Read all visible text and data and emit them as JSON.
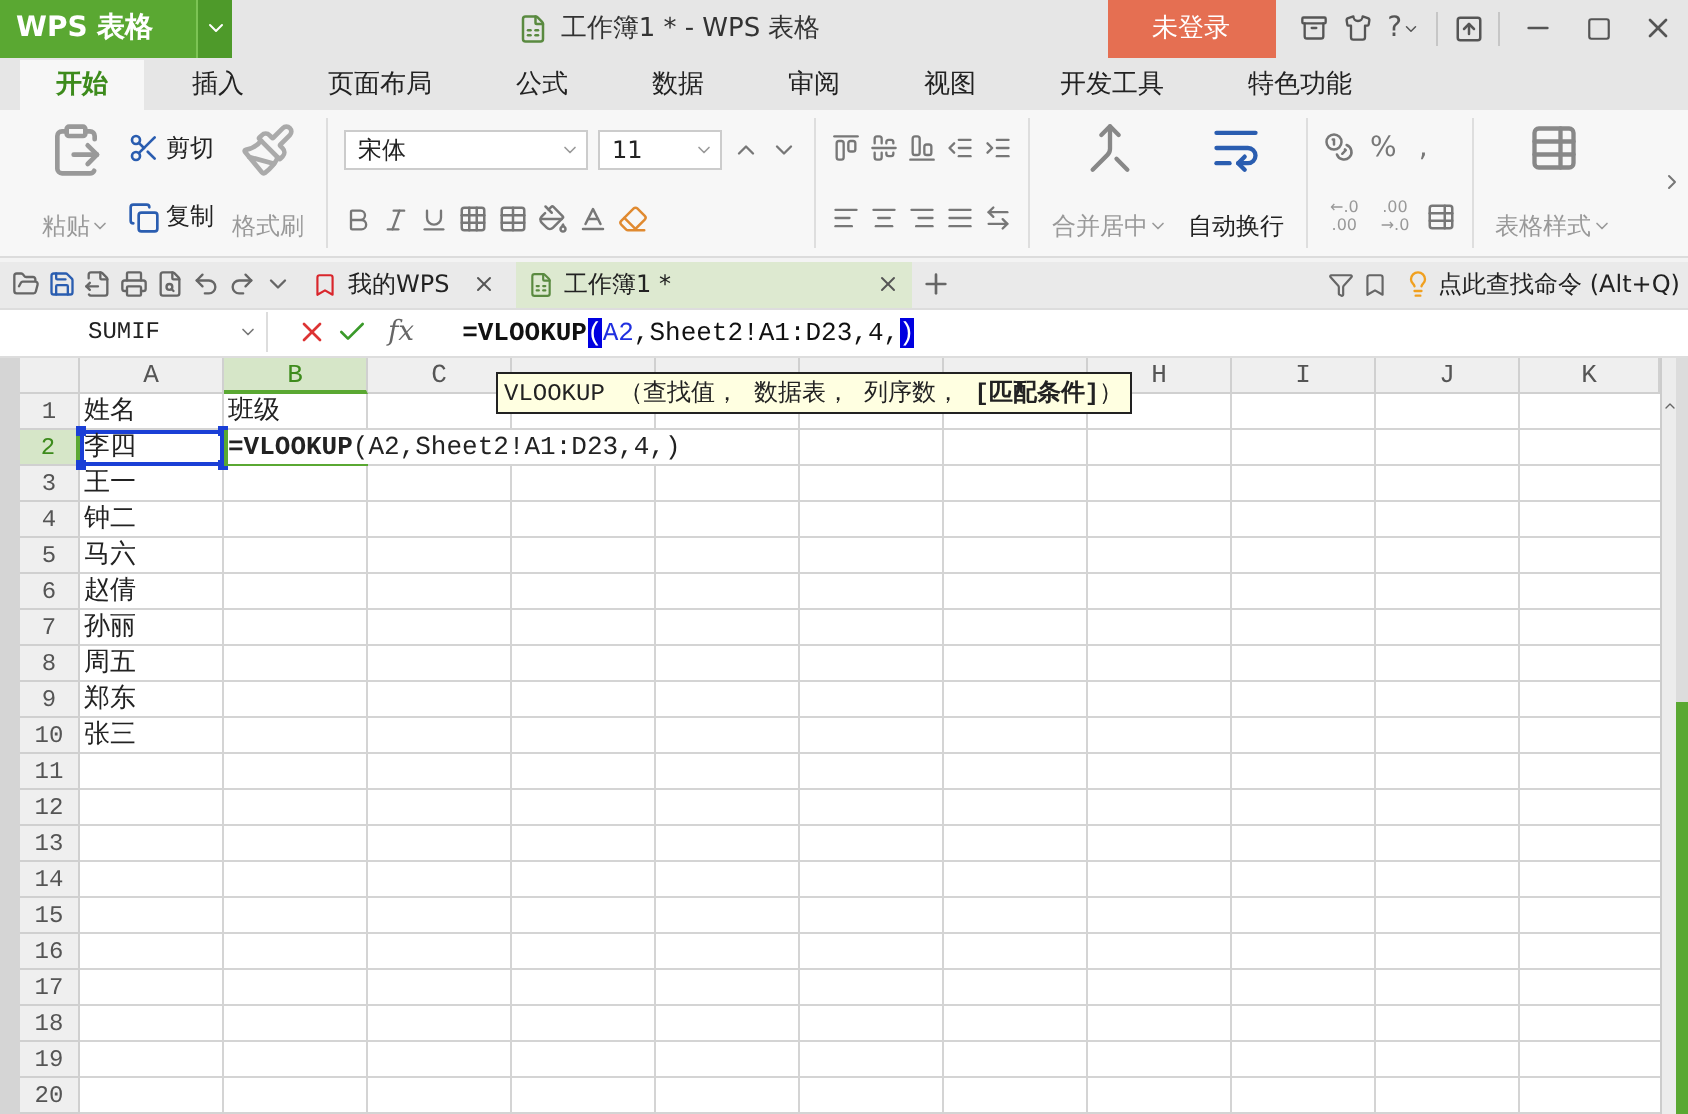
{
  "app_button": {
    "label": "WPS 表格"
  },
  "window": {
    "title": "工作簿1 * - WPS 表格"
  },
  "login_button": {
    "label": "未登录"
  },
  "help_button": {
    "label": "?"
  },
  "menu_tabs": [
    {
      "label": "开始",
      "selected": true
    },
    {
      "label": "插入",
      "selected": false
    },
    {
      "label": "页面布局",
      "selected": false
    },
    {
      "label": "公式",
      "selected": false
    },
    {
      "label": "数据",
      "selected": false
    },
    {
      "label": "审阅",
      "selected": false
    },
    {
      "label": "视图",
      "selected": false
    },
    {
      "label": "开发工具",
      "selected": false
    },
    {
      "label": "特色功能",
      "selected": false
    }
  ],
  "ribbon": {
    "paste": {
      "label": "粘贴",
      "disabled": true
    },
    "cut": {
      "label": "剪切",
      "disabled": false
    },
    "copy": {
      "label": "复制",
      "disabled": false
    },
    "format_painter": {
      "label": "格式刷",
      "disabled": true
    },
    "font_name": "宋体",
    "font_size": "11",
    "merge_center": {
      "label": "合并居中",
      "disabled": true
    },
    "wrap_text": {
      "label": "自动换行",
      "disabled": false
    },
    "percent": "%",
    "comma": ",",
    "decimal_buttons": [
      {
        "top": "←.0",
        "bottom": ".00"
      },
      {
        "top": ".00",
        "bottom": "→.0"
      }
    ],
    "table_style": {
      "label": "表格样式",
      "disabled": true
    }
  },
  "doc_tabs": [
    {
      "label": "我的WPS",
      "kind": "home",
      "selected": false
    },
    {
      "label": "工作簿1 *",
      "kind": "sheet",
      "selected": true
    }
  ],
  "command_search": "点此查找命令 (Alt+Q)",
  "formula_bar": {
    "name_box": "SUMIF",
    "function_button": "fx",
    "formula": [
      {
        "text": "=VLOOKUP",
        "kind": "bold"
      },
      {
        "text": "(",
        "kind": "highlight"
      },
      {
        "text": "A2",
        "kind": "ref"
      },
      {
        "text": ",Sheet2!A1:D23,4,",
        "kind": "plain"
      },
      {
        "text": ")",
        "kind": "highlight"
      }
    ]
  },
  "tooltip": "VLOOKUP （查找值， 数据表， 列序数， **[匹配条件]**）",
  "grid": {
    "columns": [
      {
        "label": "A",
        "selected": false
      },
      {
        "label": "B",
        "selected": true
      },
      {
        "label": "C",
        "selected": false
      },
      {
        "selected": false
      },
      {
        "selected": false
      },
      {
        "selected": false
      },
      {
        "selected": false
      },
      {
        "label": "H",
        "selected": false
      },
      {
        "label": "I",
        "selected": false
      },
      {
        "label": "J",
        "selected": false
      },
      {
        "label": "K",
        "selected": false
      }
    ],
    "rows": [
      {
        "label": "1",
        "selected": false,
        "cells": [
          {
            "text": "姓名",
            "selected": false,
            "editing": false
          },
          {
            "text": "班级",
            "selected": false,
            "editing": false
          }
        ]
      },
      {
        "label": "2",
        "selected": true,
        "cells": [
          {
            "text": "李四",
            "selected": true,
            "editing": false
          },
          {
            "text": "**=VLOOKUP**(A2,Sheet2!A1:D23,4,)",
            "selected": false,
            "editing": true
          }
        ]
      },
      {
        "label": "3",
        "selected": false,
        "cells": [
          {
            "text": "王一",
            "selected": false,
            "editing": false
          }
        ]
      },
      {
        "label": "4",
        "selected": false,
        "cells": [
          {
            "text": "钟二",
            "selected": false,
            "editing": false
          }
        ]
      },
      {
        "label": "5",
        "selected": false,
        "cells": [
          {
            "text": "马六",
            "selected": false,
            "editing": false
          }
        ]
      },
      {
        "label": "6",
        "selected": false,
        "cells": [
          {
            "text": "赵倩",
            "selected": false,
            "editing": false
          }
        ]
      },
      {
        "label": "7",
        "selected": false,
        "cells": [
          {
            "text": "孙丽",
            "selected": false,
            "editing": false
          }
        ]
      },
      {
        "label": "8",
        "selected": false,
        "cells": [
          {
            "text": "周五",
            "selected": false,
            "editing": false
          }
        ]
      },
      {
        "label": "9",
        "selected": false,
        "cells": [
          {
            "text": "郑东",
            "selected": false,
            "editing": false
          }
        ]
      },
      {
        "label": "10",
        "selected": false,
        "cells": [
          {
            "text": "张三",
            "selected": false,
            "editing": false
          }
        ]
      },
      {
        "label": "11",
        "selected": false
      },
      {
        "label": "12",
        "selected": false
      },
      {
        "label": "13",
        "selected": false
      },
      {
        "label": "14",
        "selected": false
      },
      {
        "label": "15",
        "selected": false
      },
      {
        "label": "16",
        "selected": false
      },
      {
        "label": "17",
        "selected": false
      },
      {
        "label": "18",
        "selected": false
      },
      {
        "label": "19",
        "selected": false
      },
      {
        "label": "20",
        "selected": false
      }
    ]
  }
}
